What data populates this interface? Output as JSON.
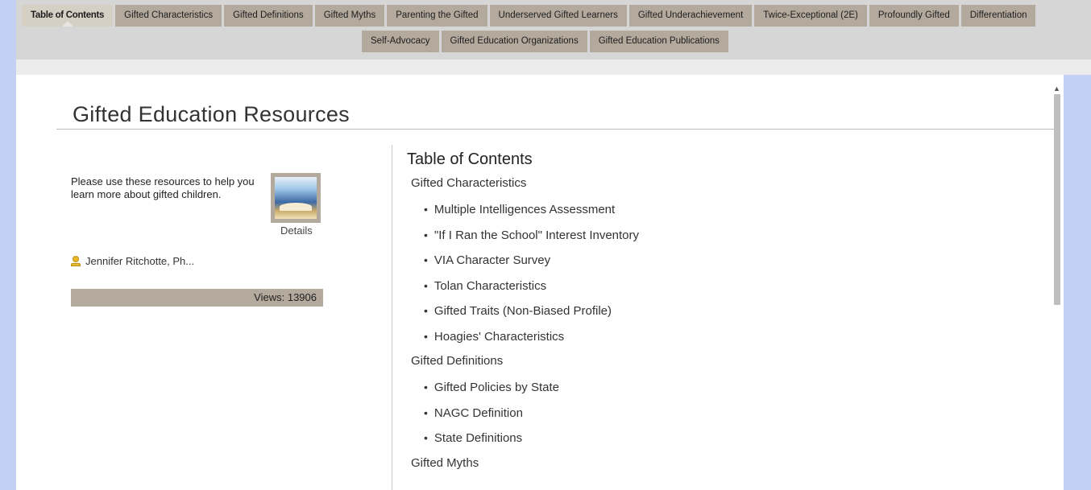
{
  "tabs_row1": [
    {
      "label": "Table of Contents",
      "active": true
    },
    {
      "label": "Gifted Characteristics",
      "active": false
    },
    {
      "label": "Gifted Definitions",
      "active": false
    },
    {
      "label": "Gifted Myths",
      "active": false
    },
    {
      "label": "Parenting the Gifted",
      "active": false
    },
    {
      "label": "Underserved Gifted Learners",
      "active": false
    },
    {
      "label": "Gifted Underachievement",
      "active": false
    },
    {
      "label": "Twice-Exceptional (2E)",
      "active": false
    },
    {
      "label": "Profoundly Gifted",
      "active": false
    },
    {
      "label": "Differentiation",
      "active": false
    }
  ],
  "tabs_row2": [
    {
      "label": "Self-Advocacy",
      "active": false
    },
    {
      "label": "Gifted Education Organizations",
      "active": false
    },
    {
      "label": "Gifted Education Publications",
      "active": false
    }
  ],
  "page": {
    "title": "Gifted Education Resources"
  },
  "sidebar": {
    "intro": "Please use these resources to help you learn more about gifted children.",
    "details_label": "Details",
    "author": "Jennifer Ritchotte, Ph...",
    "views": "Views: 13906",
    "author_icon": "user-icon",
    "thumbnail_icon": "book-image"
  },
  "toc": {
    "heading": "Table of Contents",
    "sections": [
      {
        "title": "Gifted Characteristics",
        "items": [
          "Multiple Intelligences Assessment",
          "\"If I Ran the School\" Interest Inventory",
          "VIA Character Survey",
          "Tolan Characteristics",
          "Gifted Traits (Non-Biased Profile)",
          "Hoagies' Characteristics"
        ]
      },
      {
        "title": "Gifted Definitions",
        "items": [
          "Gifted Policies by State",
          "NAGC Definition",
          "State Definitions"
        ]
      },
      {
        "title": "Gifted Myths",
        "items": []
      }
    ]
  },
  "colors": {
    "tab_bg": "#b3aa9d",
    "tab_active_bg": "#d6cfc4",
    "page_bg": "#c3cff5"
  }
}
